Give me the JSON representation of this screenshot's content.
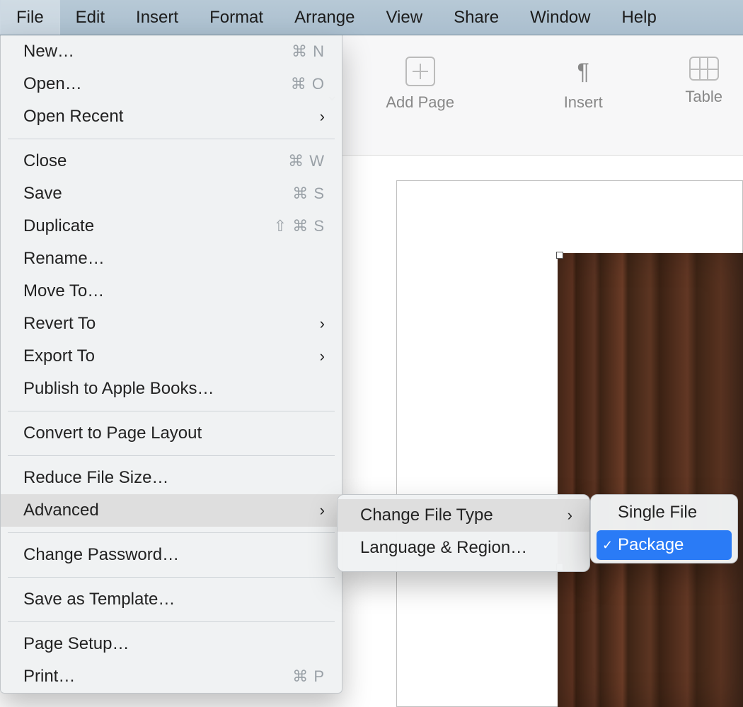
{
  "menubar": [
    "File",
    "Edit",
    "Insert",
    "Format",
    "Arrange",
    "View",
    "Share",
    "Window",
    "Help"
  ],
  "toolbar": {
    "addpage": "Add Page",
    "insert": "Insert",
    "table": "Table"
  },
  "file_menu": {
    "new": {
      "label": "New…",
      "shortcut": "⌘ N"
    },
    "open": {
      "label": "Open…",
      "shortcut": "⌘ O"
    },
    "open_recent": {
      "label": "Open Recent"
    },
    "close": {
      "label": "Close",
      "shortcut": "⌘ W"
    },
    "save": {
      "label": "Save",
      "shortcut": "⌘ S"
    },
    "duplicate": {
      "label": "Duplicate",
      "shortcut": "⇧ ⌘ S"
    },
    "rename": {
      "label": "Rename…"
    },
    "move_to": {
      "label": "Move To…"
    },
    "revert_to": {
      "label": "Revert To"
    },
    "export_to": {
      "label": "Export To"
    },
    "publish": {
      "label": "Publish to Apple Books…"
    },
    "convert": {
      "label": "Convert to Page Layout"
    },
    "reduce": {
      "label": "Reduce File Size…"
    },
    "advanced": {
      "label": "Advanced"
    },
    "change_pw": {
      "label": "Change Password…"
    },
    "save_tmpl": {
      "label": "Save as Template…"
    },
    "page_setup": {
      "label": "Page Setup…"
    },
    "print": {
      "label": "Print…",
      "shortcut": "⌘ P"
    }
  },
  "advanced_menu": {
    "change_file_type": "Change File Type",
    "language_region": "Language & Region…"
  },
  "file_type_menu": {
    "single_file": "Single File",
    "package": "Package"
  }
}
